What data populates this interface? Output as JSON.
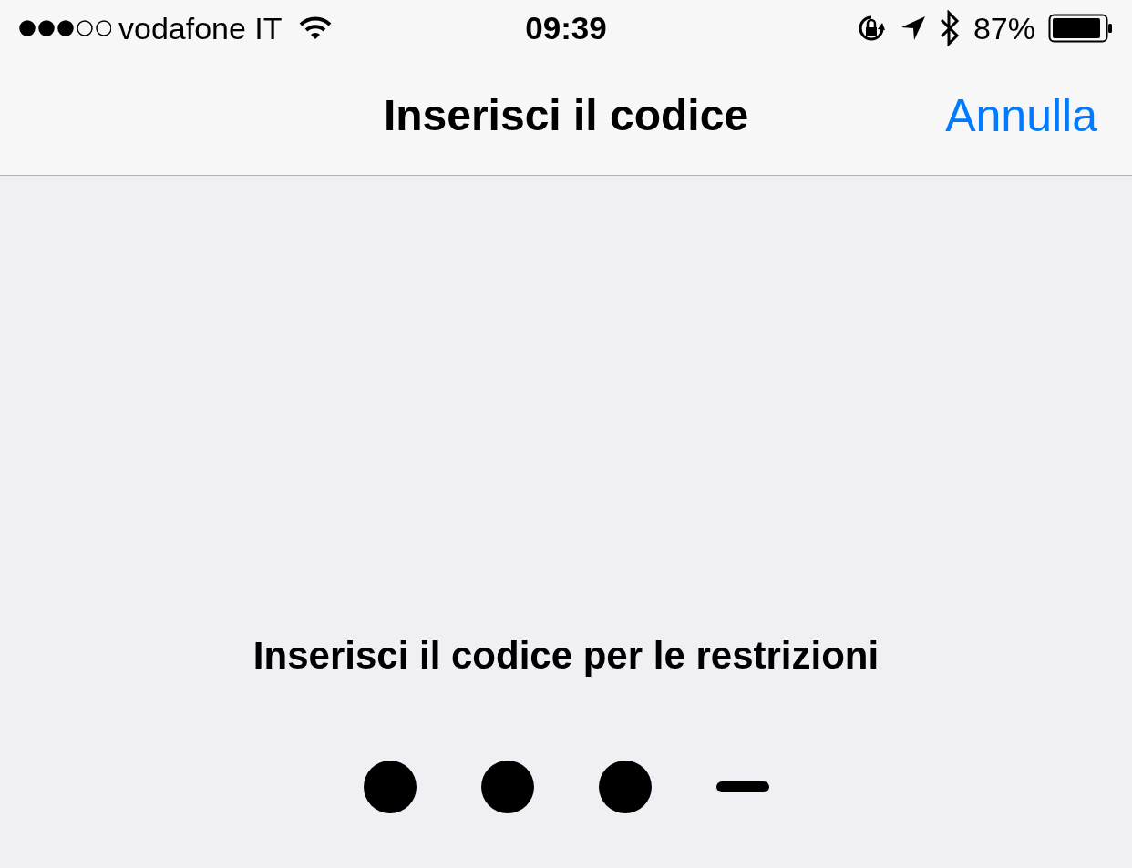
{
  "status_bar": {
    "carrier": "vodafone IT",
    "time": "09:39",
    "battery": "87%"
  },
  "nav_bar": {
    "title": "Inserisci il codice",
    "cancel": "Annulla"
  },
  "prompt": "Inserisci il codice per le restrizioni",
  "passcode_slots": [
    {
      "filled": true
    },
    {
      "filled": true
    },
    {
      "filled": true
    },
    {
      "filled": false
    }
  ]
}
